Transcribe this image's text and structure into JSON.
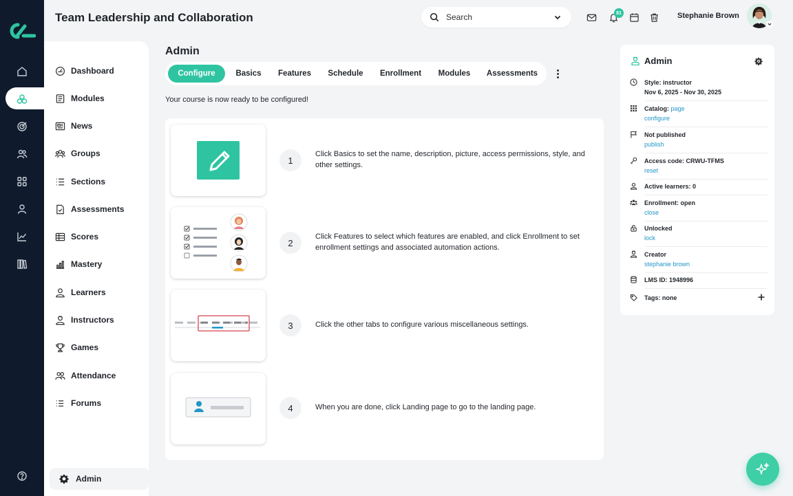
{
  "header": {
    "title": "Team Leadership and Collaboration",
    "search_placeholder": "Search",
    "notification_count": "81",
    "user_name": "Stephanie Brown"
  },
  "sidebar": {
    "items": [
      {
        "label": "Dashboard",
        "icon": "dashboard-icon"
      },
      {
        "label": "Modules",
        "icon": "modules-icon"
      },
      {
        "label": "News",
        "icon": "news-icon"
      },
      {
        "label": "Groups",
        "icon": "groups-icon"
      },
      {
        "label": "Sections",
        "icon": "sections-icon"
      },
      {
        "label": "Assessments",
        "icon": "assessments-icon"
      },
      {
        "label": "Scores",
        "icon": "scores-icon"
      },
      {
        "label": "Mastery",
        "icon": "mastery-icon"
      },
      {
        "label": "Learners",
        "icon": "learners-icon"
      },
      {
        "label": "Instructors",
        "icon": "instructors-icon"
      },
      {
        "label": "Games",
        "icon": "games-icon"
      },
      {
        "label": "Attendance",
        "icon": "attendance-icon"
      },
      {
        "label": "Forums",
        "icon": "forums-icon"
      }
    ],
    "admin_label": "Admin"
  },
  "main": {
    "heading": "Admin",
    "tabs": [
      "Configure",
      "Basics",
      "Features",
      "Schedule",
      "Enrollment",
      "Modules",
      "Assessments"
    ],
    "active_tab": "Configure",
    "ready_text": "Your course is now ready to be configured!",
    "steps": [
      {
        "num": "1",
        "text": "Click Basics to set the name, description, picture, access permissions, style, and other settings."
      },
      {
        "num": "2",
        "text": "Click Features to select which features are enabled, and click Enrollment to set enrollment settings and associated automation actions."
      },
      {
        "num": "3",
        "text": "Click the other tabs to configure various miscellaneous settings."
      },
      {
        "num": "4",
        "text": "When you are done, click Landing page to go to the landing page."
      }
    ]
  },
  "panel": {
    "title": "Admin",
    "style_label": "Style: instructor",
    "dates": "Nov 6, 2025 - Nov 30, 2025",
    "catalog_label": "Catalog:",
    "catalog_link": "page",
    "catalog_configure": "configure",
    "publish_status": "Not published",
    "publish_link": "publish",
    "access_code": "Access code: CRWU-TFMS",
    "access_reset": "reset",
    "active_learners": "Active learners: 0",
    "enrollment": "Enrollment: open",
    "enrollment_link": "close",
    "lock_status": "Unlocked",
    "lock_link": "lock",
    "creator_label": "Creator",
    "creator_link": "stephanie brown",
    "lms_id": "LMS ID: 1948996",
    "tags": "Tags: none"
  },
  "colors": {
    "accent": "#2ec4a1",
    "rail": "#0f1b2d",
    "link": "#2196c8"
  }
}
